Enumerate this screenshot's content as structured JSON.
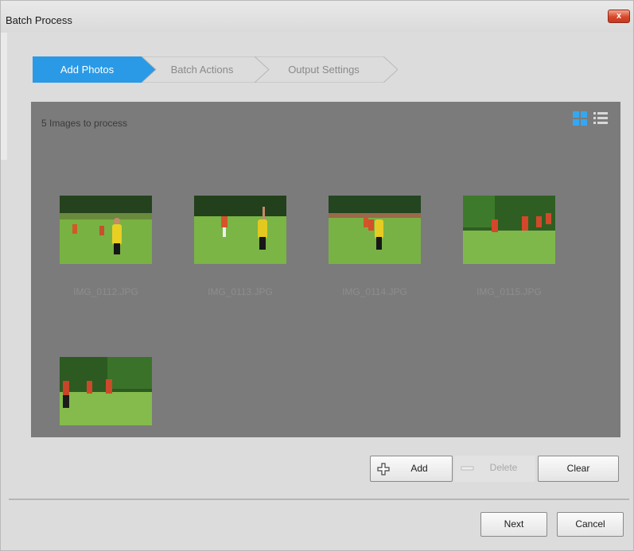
{
  "window": {
    "title": "Batch Process",
    "close_label": "x"
  },
  "steps": [
    {
      "label": "Add Photos",
      "active": true
    },
    {
      "label": "Batch Actions",
      "active": false
    },
    {
      "label": "Output Settings",
      "active": false
    }
  ],
  "gallery": {
    "count_text": "5 Images to process",
    "view_mode": "grid",
    "images": [
      {
        "name": "IMG_0112.JPG"
      },
      {
        "name": "IMG_0113.JPG"
      },
      {
        "name": "IMG_0114.JPG"
      },
      {
        "name": "IMG_0115.JPG"
      },
      {
        "name": ""
      }
    ]
  },
  "actions": {
    "add_label": "Add",
    "delete_label": "Delete",
    "clear_label": "Clear"
  },
  "footer": {
    "next_label": "Next",
    "cancel_label": "Cancel"
  },
  "colors": {
    "accent": "#2a9ae6",
    "gallery_bg": "#7b7b7b",
    "window_bg": "#dcdcdc"
  }
}
